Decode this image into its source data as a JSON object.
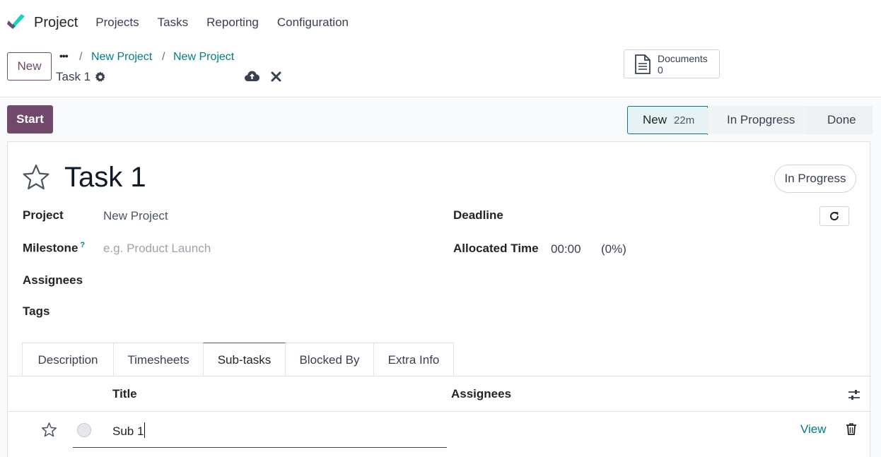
{
  "navbar": {
    "app_name": "Project",
    "menu": [
      "Projects",
      "Tasks",
      "Reporting",
      "Configuration"
    ]
  },
  "control_panel": {
    "new_label": "New",
    "breadcrumbs": [
      "New Project",
      "New Project"
    ],
    "record_name": "Task 1",
    "documents_label": "Documents",
    "documents_count": "0"
  },
  "statusbar": {
    "start_label": "Start",
    "stages": [
      {
        "label": "New",
        "duration": "22m",
        "active": true
      },
      {
        "label": "In Propgress"
      },
      {
        "label": "Done"
      }
    ]
  },
  "form": {
    "title": "Task 1",
    "state": "In Progress",
    "fields": {
      "project_label": "Project",
      "project_value": "New Project",
      "milestone_label": "Milestone",
      "milestone_help": "?",
      "milestone_placeholder": "e.g. Product Launch",
      "assignees_label": "Assignees",
      "tags_label": "Tags",
      "deadline_label": "Deadline",
      "allocated_label": "Allocated Time",
      "allocated_value": "00:00",
      "allocated_percent": "(0%)"
    },
    "tabs": [
      "Description",
      "Timesheets",
      "Sub-tasks",
      "Blocked By",
      "Extra Info"
    ],
    "active_tab": "Sub-tasks"
  },
  "subtasks": {
    "columns": [
      "Title",
      "Assignees"
    ],
    "rows": [
      {
        "title": "Sub 1",
        "view_label": "View"
      }
    ]
  },
  "colors": {
    "brand": "#71496a",
    "accent": "#017e84"
  }
}
